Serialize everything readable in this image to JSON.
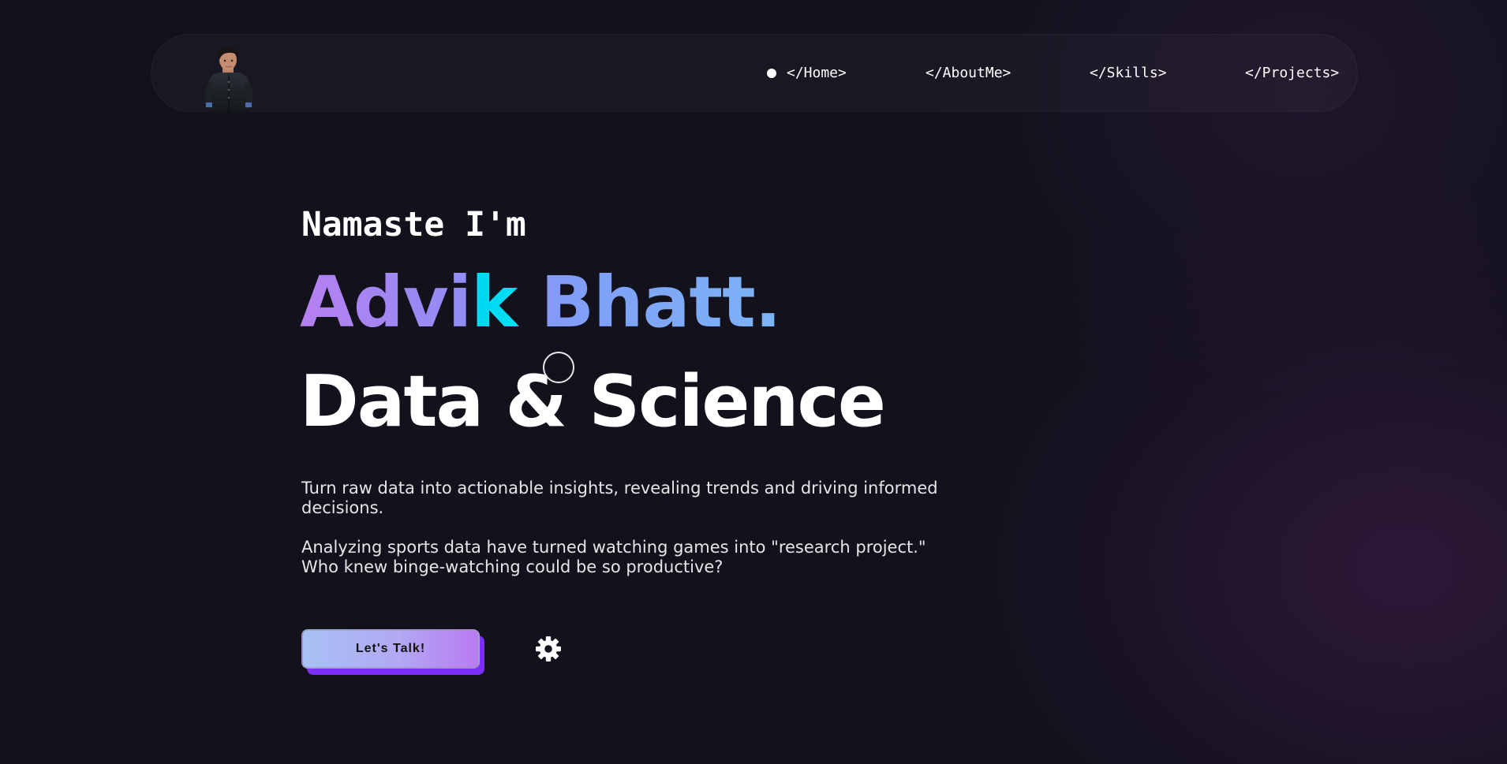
{
  "nav": {
    "items": [
      {
        "label": "</Home>",
        "active": true
      },
      {
        "label": "</AboutMe>",
        "active": false
      },
      {
        "label": "</Skills>",
        "active": false
      },
      {
        "label": "</Projects>",
        "active": false
      }
    ]
  },
  "hero": {
    "greeting": "Namaste I'm",
    "name_part1": "Advi",
    "name_highlight": "k",
    "name_part2": " Bhatt.",
    "role": "Data & Science",
    "paragraph1": "Turn raw data into actionable insights, revealing trends and driving informed decisions.",
    "paragraph2": "Analyzing sports data have turned watching games into \"research project.\" Who knew binge-watching could be so productive?",
    "cta_label": "Let's Talk!"
  },
  "icons": {
    "avatar": "avatar-icon",
    "active_indicator": "dot-icon",
    "settings": "gear-icon"
  },
  "colors": {
    "background": "#12111c",
    "name_gradient_start": "#b67ff0",
    "name_gradient_end": "#7cb4f5",
    "name_highlight": "#00d4f0",
    "cta_shadow": "#7b2ff7"
  }
}
